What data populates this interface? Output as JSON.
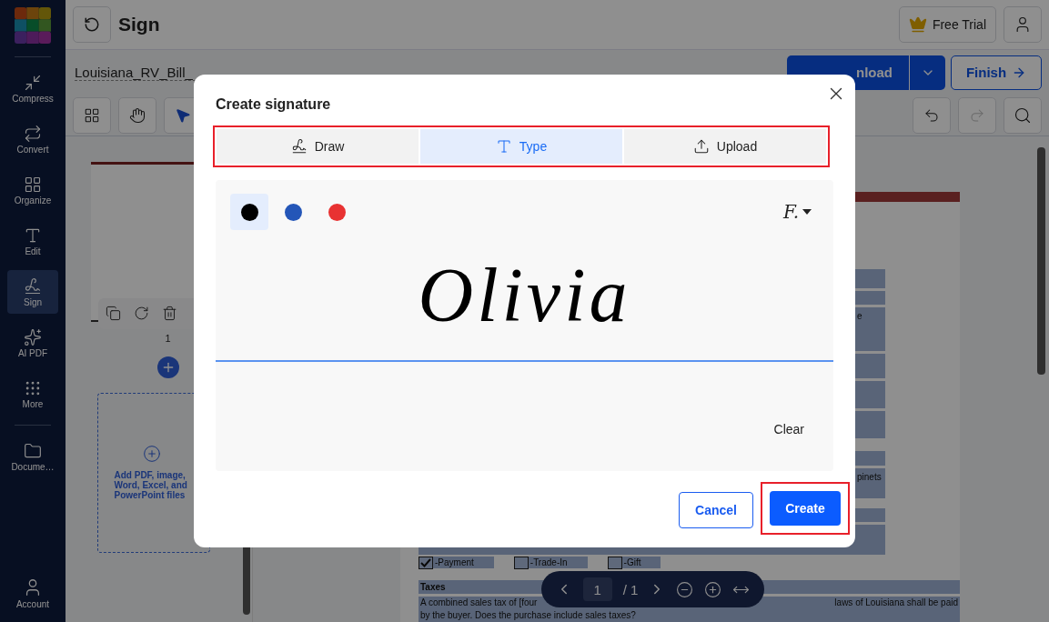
{
  "sidebar": {
    "items": [
      {
        "label": "Compress",
        "kind": "compress",
        "selected": false
      },
      {
        "label": "Convert",
        "kind": "convert",
        "selected": false
      },
      {
        "label": "Organize",
        "kind": "organize",
        "selected": false
      },
      {
        "label": "Edit",
        "kind": "edit",
        "selected": false
      },
      {
        "label": "Sign",
        "kind": "sign",
        "selected": true
      },
      {
        "label": "AI PDF",
        "kind": "ai",
        "selected": false
      },
      {
        "label": "More",
        "kind": "more",
        "selected": false
      },
      {
        "label": "Docume…",
        "kind": "documents",
        "selected": false
      }
    ],
    "account": "Account"
  },
  "header": {
    "title": "Sign",
    "free_trial": "Free Trial"
  },
  "file": {
    "name": "Louisiana_RV_Bill_"
  },
  "actions": {
    "download": "nload",
    "finish": "Finish"
  },
  "thumbnails": {
    "page_number": "1",
    "dropzone": "Add PDF, image, Word, Excel, and PowerPoint files"
  },
  "document": {
    "field_texts": [
      "e",
      "pinets"
    ],
    "options": [
      {
        "label": "-Payment",
        "checked": true
      },
      {
        "label": "-Trade-In",
        "checked": false
      },
      {
        "label": "-Gift",
        "checked": false
      }
    ],
    "section": "Taxes",
    "paragraph": [
      "A combined sales tax of [four",
      "laws of Louisiana shall be paid",
      "by the buyer. Does the purchase include sales taxes?"
    ]
  },
  "pager": {
    "current": "1",
    "total": "/ 1"
  },
  "dialog": {
    "title": "Create signature",
    "tabs": [
      {
        "label": "Draw",
        "kind": "draw",
        "selected": false
      },
      {
        "label": "Type",
        "kind": "type",
        "selected": true
      },
      {
        "label": "Upload",
        "kind": "upload",
        "selected": false
      }
    ],
    "colors": [
      {
        "color": "#000000",
        "selected": true
      },
      {
        "color": "#2456b8",
        "selected": false
      },
      {
        "color": "#e83232",
        "selected": false
      }
    ],
    "font_button": "F.",
    "signature": "Olivia",
    "clear": "Clear",
    "cancel": "Cancel",
    "create": "Create"
  }
}
